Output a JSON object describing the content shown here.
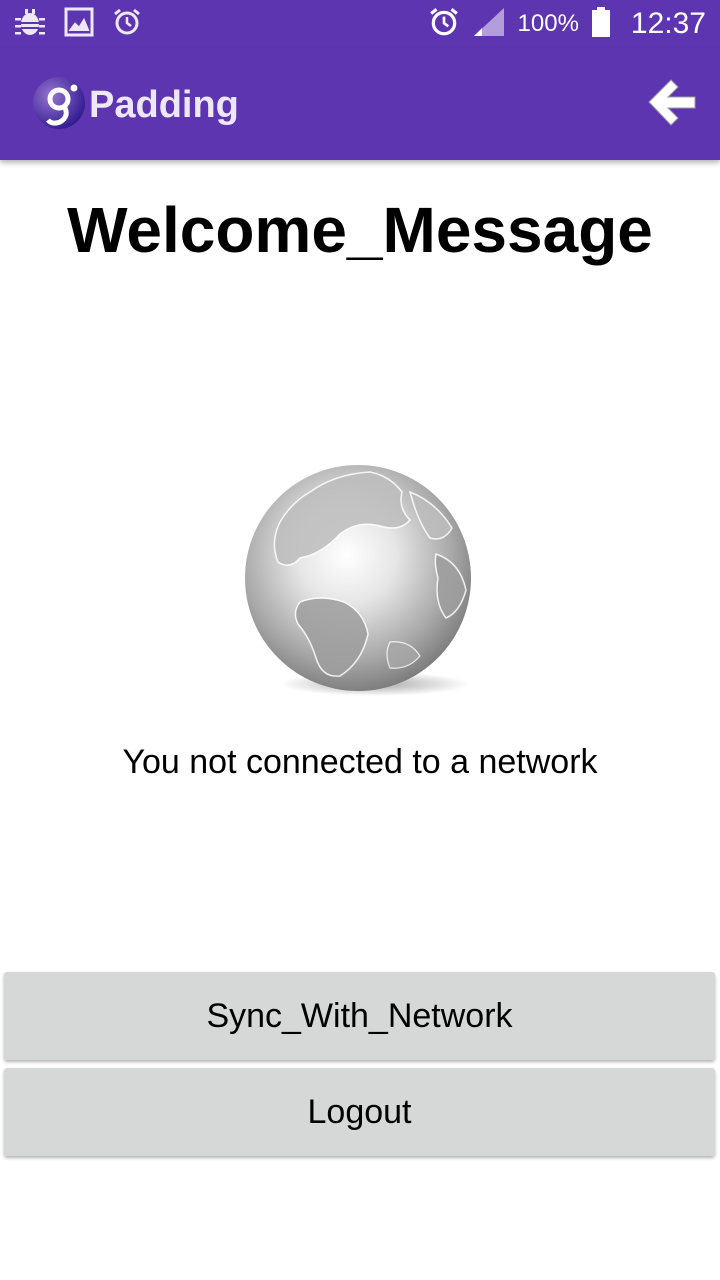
{
  "status_bar": {
    "battery_level": "100%",
    "time": "12:37",
    "left_icons": [
      "bug-icon",
      "image-icon",
      "alarm-icon"
    ],
    "right_icons": [
      "alarm-icon",
      "signal-icon",
      "battery-icon"
    ]
  },
  "app_bar": {
    "title": "Padding",
    "logo_icon": "app-logo-icon",
    "back_icon": "back-arrow-icon",
    "background_color": "#5e35b1"
  },
  "main": {
    "welcome_message": "Welcome_Message",
    "globe_icon": "globe-icon",
    "network_status": "You not connected to a network"
  },
  "buttons": {
    "sync_label": "Sync_With_Network",
    "logout_label": "Logout",
    "button_color": "#d6d7d7"
  }
}
